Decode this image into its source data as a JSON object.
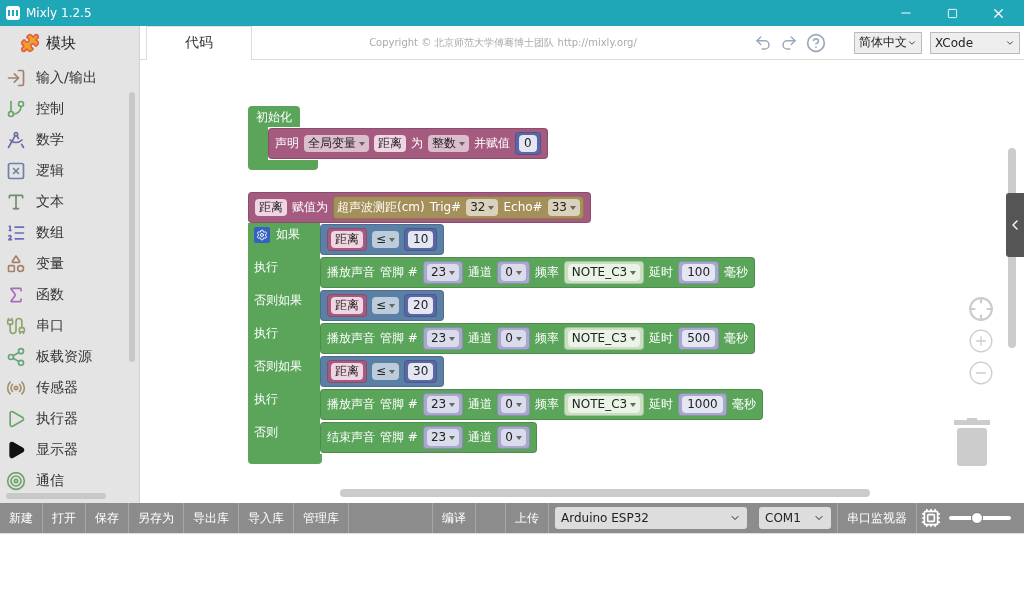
{
  "window": {
    "title": "Mixly 1.2.5"
  },
  "sidebar": {
    "header": "模块",
    "categories": [
      {
        "label": "输入/输出"
      },
      {
        "label": "控制"
      },
      {
        "label": "数学"
      },
      {
        "label": "逻辑"
      },
      {
        "label": "文本"
      },
      {
        "label": "数组"
      },
      {
        "label": "变量"
      },
      {
        "label": "函数"
      },
      {
        "label": "串口"
      },
      {
        "label": "板载资源"
      },
      {
        "label": "传感器"
      },
      {
        "label": "执行器"
      },
      {
        "label": "显示器"
      },
      {
        "label": "通信"
      }
    ]
  },
  "topbar": {
    "tab": "代码",
    "copyright": "Copyright © 北京师范大学傅骞博士团队 http://mixly.org/",
    "language": "简体中文",
    "theme": "XCode"
  },
  "workspace": {
    "blocks": [
      {
        "kind": "container",
        "color": "#5ba55b",
        "label": "初始化",
        "body": [
          {
            "color": "#a55b80",
            "parts": [
              {
                "kind": "label",
                "text": "声明"
              },
              {
                "kind": "dropdown",
                "text": "全局变量"
              },
              {
                "kind": "var",
                "text": "距离"
              },
              {
                "kind": "label",
                "text": "为"
              },
              {
                "kind": "dropdown",
                "text": "整数"
              },
              {
                "kind": "label",
                "text": "并赋值"
              },
              {
                "kind": "input",
                "block": {
                  "color": "#5b67a5",
                  "parts": [
                    {
                      "kind": "number",
                      "text": "0"
                    }
                  ]
                }
              }
            ]
          }
        ]
      },
      {
        "kind": "stack",
        "items": [
          {
            "kind": "statement",
            "color": "#a55b80",
            "parts": [
              {
                "kind": "var",
                "text": "距离"
              },
              {
                "kind": "label",
                "text": "赋值为"
              },
              {
                "kind": "input",
                "block": {
                  "color": "#a5905b",
                  "parts": [
                    {
                      "kind": "label",
                      "text": "超声波测距(cm)"
                    },
                    {
                      "kind": "label",
                      "text": "Trig#"
                    },
                    {
                      "kind": "dropdown",
                      "text": "32"
                    },
                    {
                      "kind": "label",
                      "text": "Echo#"
                    },
                    {
                      "kind": "dropdown",
                      "text": "33"
                    }
                  ]
                }
              }
            ]
          },
          {
            "kind": "if",
            "color": "#5ba55b",
            "rows": [
              {
                "label": "如果",
                "block": {
                  "color": "#5b80a5",
                  "parts": [
                    {
                      "kind": "input",
                      "block": {
                        "color": "#a55b80",
                        "parts": [
                          {
                            "kind": "var",
                            "text": "距离"
                          }
                        ]
                      }
                    },
                    {
                      "kind": "dropdown",
                      "text": "≤"
                    },
                    {
                      "kind": "input",
                      "block": {
                        "color": "#5b67a5",
                        "parts": [
                          {
                            "kind": "number",
                            "text": "10"
                          }
                        ]
                      }
                    }
                  ]
                }
              },
              {
                "label": "执行",
                "block": {
                  "color": "#5ba55b",
                  "parts": [
                    {
                      "kind": "label",
                      "text": "播放声音"
                    },
                    {
                      "kind": "label",
                      "text": "管脚 #"
                    },
                    {
                      "kind": "input",
                      "block": {
                        "color": "#a6a9cc",
                        "parts": [
                          {
                            "kind": "dropdown",
                            "text": "23"
                          }
                        ]
                      }
                    },
                    {
                      "kind": "label",
                      "text": "通道"
                    },
                    {
                      "kind": "input",
                      "block": {
                        "color": "#a6a9cc",
                        "parts": [
                          {
                            "kind": "dropdown",
                            "text": "0"
                          }
                        ]
                      }
                    },
                    {
                      "kind": "label",
                      "text": "频率"
                    },
                    {
                      "kind": "input",
                      "block": {
                        "color": "#c8e0c0",
                        "parts": [
                          {
                            "kind": "dropdown",
                            "text": "NOTE_C3"
                          }
                        ]
                      }
                    },
                    {
                      "kind": "label",
                      "text": "延时"
                    },
                    {
                      "kind": "input",
                      "block": {
                        "color": "#a6a9cc",
                        "parts": [
                          {
                            "kind": "number",
                            "text": "100"
                          }
                        ]
                      }
                    },
                    {
                      "kind": "label",
                      "text": "毫秒"
                    }
                  ]
                }
              },
              {
                "label": "否则如果",
                "block": {
                  "color": "#5b80a5",
                  "parts": [
                    {
                      "kind": "input",
                      "block": {
                        "color": "#a55b80",
                        "parts": [
                          {
                            "kind": "var",
                            "text": "距离"
                          }
                        ]
                      }
                    },
                    {
                      "kind": "dropdown",
                      "text": "≤"
                    },
                    {
                      "kind": "input",
                      "block": {
                        "color": "#5b67a5",
                        "parts": [
                          {
                            "kind": "number",
                            "text": "20"
                          }
                        ]
                      }
                    }
                  ]
                }
              },
              {
                "label": "执行",
                "block": {
                  "color": "#5ba55b",
                  "parts": [
                    {
                      "kind": "label",
                      "text": "播放声音"
                    },
                    {
                      "kind": "label",
                      "text": "管脚 #"
                    },
                    {
                      "kind": "input",
                      "block": {
                        "color": "#a6a9cc",
                        "parts": [
                          {
                            "kind": "dropdown",
                            "text": "23"
                          }
                        ]
                      }
                    },
                    {
                      "kind": "label",
                      "text": "通道"
                    },
                    {
                      "kind": "input",
                      "block": {
                        "color": "#a6a9cc",
                        "parts": [
                          {
                            "kind": "dropdown",
                            "text": "0"
                          }
                        ]
                      }
                    },
                    {
                      "kind": "label",
                      "text": "频率"
                    },
                    {
                      "kind": "input",
                      "block": {
                        "color": "#c8e0c0",
                        "parts": [
                          {
                            "kind": "dropdown",
                            "text": "NOTE_C3"
                          }
                        ]
                      }
                    },
                    {
                      "kind": "label",
                      "text": "延时"
                    },
                    {
                      "kind": "input",
                      "block": {
                        "color": "#a6a9cc",
                        "parts": [
                          {
                            "kind": "number",
                            "text": "500"
                          }
                        ]
                      }
                    },
                    {
                      "kind": "label",
                      "text": "毫秒"
                    }
                  ]
                }
              },
              {
                "label": "否则如果",
                "block": {
                  "color": "#5b80a5",
                  "parts": [
                    {
                      "kind": "input",
                      "block": {
                        "color": "#a55b80",
                        "parts": [
                          {
                            "kind": "var",
                            "text": "距离"
                          }
                        ]
                      }
                    },
                    {
                      "kind": "dropdown",
                      "text": "≤"
                    },
                    {
                      "kind": "input",
                      "block": {
                        "color": "#5b67a5",
                        "parts": [
                          {
                            "kind": "number",
                            "text": "30"
                          }
                        ]
                      }
                    }
                  ]
                }
              },
              {
                "label": "执行",
                "block": {
                  "color": "#5ba55b",
                  "parts": [
                    {
                      "kind": "label",
                      "text": "播放声音"
                    },
                    {
                      "kind": "label",
                      "text": "管脚 #"
                    },
                    {
                      "kind": "input",
                      "block": {
                        "color": "#a6a9cc",
                        "parts": [
                          {
                            "kind": "dropdown",
                            "text": "23"
                          }
                        ]
                      }
                    },
                    {
                      "kind": "label",
                      "text": "通道"
                    },
                    {
                      "kind": "input",
                      "block": {
                        "color": "#a6a9cc",
                        "parts": [
                          {
                            "kind": "dropdown",
                            "text": "0"
                          }
                        ]
                      }
                    },
                    {
                      "kind": "label",
                      "text": "频率"
                    },
                    {
                      "kind": "input",
                      "block": {
                        "color": "#c8e0c0",
                        "parts": [
                          {
                            "kind": "dropdown",
                            "text": "NOTE_C3"
                          }
                        ]
                      }
                    },
                    {
                      "kind": "label",
                      "text": "延时"
                    },
                    {
                      "kind": "input",
                      "block": {
                        "color": "#a6a9cc",
                        "parts": [
                          {
                            "kind": "number",
                            "text": "1000"
                          }
                        ]
                      }
                    },
                    {
                      "kind": "label",
                      "text": "毫秒"
                    }
                  ]
                }
              },
              {
                "label": "否则",
                "block": {
                  "color": "#5ba55b",
                  "parts": [
                    {
                      "kind": "label",
                      "text": "结束声音"
                    },
                    {
                      "kind": "label",
                      "text": "管脚 #"
                    },
                    {
                      "kind": "input",
                      "block": {
                        "color": "#a6a9cc",
                        "parts": [
                          {
                            "kind": "dropdown",
                            "text": "23"
                          }
                        ]
                      }
                    },
                    {
                      "kind": "label",
                      "text": "通道"
                    },
                    {
                      "kind": "input",
                      "block": {
                        "color": "#a6a9cc",
                        "parts": [
                          {
                            "kind": "dropdown",
                            "text": "0"
                          }
                        ]
                      }
                    }
                  ]
                }
              }
            ]
          }
        ]
      }
    ]
  },
  "bottom_bar": {
    "groups": [
      [
        "新建",
        "打开",
        "保存",
        "另存为",
        "导出库",
        "导入库",
        "管理库"
      ],
      [
        "编译"
      ],
      [
        "上传"
      ]
    ],
    "board": "Arduino ESP32",
    "port": "COM1",
    "serial_monitor": "串口监视器",
    "slider": {
      "level": 0.45
    }
  }
}
